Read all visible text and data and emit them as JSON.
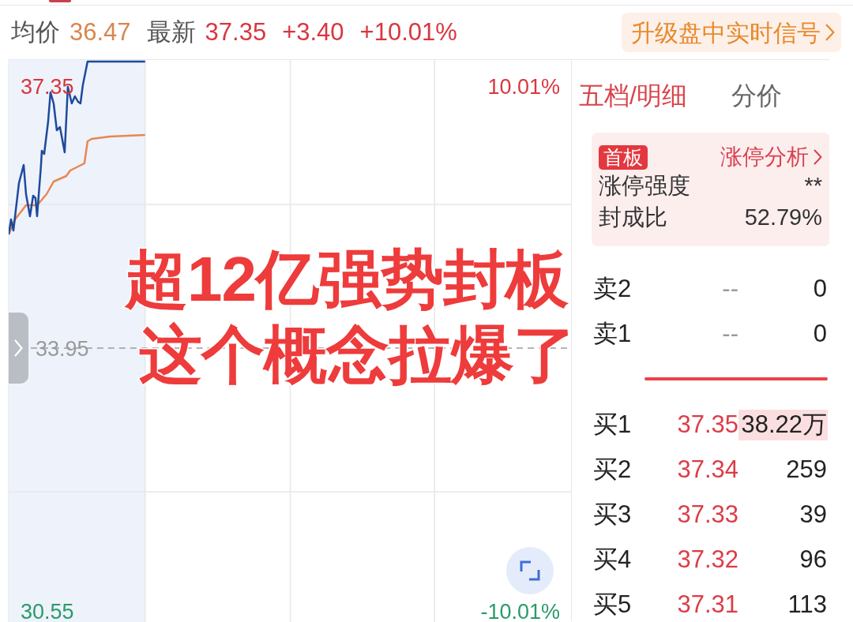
{
  "header": {
    "average_label": "均价",
    "average_price": "36.47",
    "latest_label": "最新",
    "latest_price": "37.35",
    "change": "+3.40",
    "change_percent": "+10.01%",
    "upgrade_button": "升级盘中实时信号"
  },
  "chart": {
    "price_high": "37.35",
    "percent_high": "10.01%",
    "price_base": "33.95",
    "price_low": "30.55",
    "percent_low": "-10.01%"
  },
  "order_panel": {
    "tabs": [
      {
        "label": "五档/明细",
        "selected": true
      },
      {
        "label": "分价",
        "selected": false
      }
    ],
    "limit_card": {
      "tag": "首板",
      "link": "涨停分析",
      "rows": [
        {
          "label": "涨停强度",
          "value": "**"
        },
        {
          "label": "封成比",
          "value": "52.79%"
        }
      ]
    },
    "sell_rows": [
      {
        "label": "卖2",
        "price": "--",
        "volume": "0"
      },
      {
        "label": "卖1",
        "price": "--",
        "volume": "0"
      }
    ],
    "buy_rows": [
      {
        "label": "买1",
        "price": "37.35",
        "volume": "38.22万",
        "highlighted": true
      },
      {
        "label": "买2",
        "price": "37.34",
        "volume": "259",
        "highlighted": false
      },
      {
        "label": "买3",
        "price": "37.33",
        "volume": "39",
        "highlighted": false
      },
      {
        "label": "买4",
        "price": "37.32",
        "volume": "96",
        "highlighted": false
      },
      {
        "label": "买5",
        "price": "37.31",
        "volume": "113",
        "highlighted": false
      }
    ]
  },
  "caption": {
    "lines": [
      "超12亿强势封板",
      "这个概念拉爆了"
    ]
  }
}
